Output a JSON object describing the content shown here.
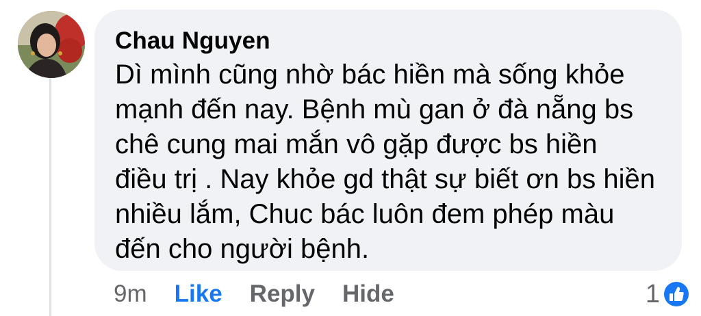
{
  "comment": {
    "author": "Chau Nguyen",
    "text": "Dì mình cũng nhờ bác hiền mà sống khỏe mạnh đến nay. Bệnh mù gan ở đà nẵng bs chê cung mai mắn vô gặp được bs hiền điều trị . Nay khỏe gd thật sự biết ơn bs hiền nhiều lắm, Chuc bác luôn đem phép màu đến cho người bệnh.",
    "timestamp": "9m",
    "reaction_count": "1",
    "reaction_icon": "like-reaction-icon"
  },
  "actions": {
    "like": "Like",
    "reply": "Reply",
    "hide": "Hide"
  },
  "colors": {
    "bubble": "#f0f2f5",
    "accent": "#1877f2",
    "muted": "#65676b",
    "text": "#050505"
  }
}
